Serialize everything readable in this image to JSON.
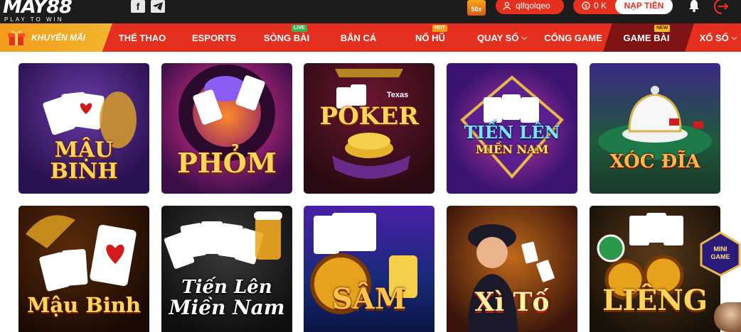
{
  "header": {
    "logo_main": "MAY88",
    "logo_tagline": "PLAY TO WIN",
    "promo_badge": "50x",
    "username": "qlfqolqeo",
    "balance": "0 K",
    "deposit_label": "NẠP TIỀN"
  },
  "nav": {
    "promo_label": "KHUYẾN MÃI",
    "items": [
      {
        "label": "THỂ THAO",
        "badge": ""
      },
      {
        "label": "ESPORTS",
        "badge": ""
      },
      {
        "label": "SÒNG BÀI",
        "badge": "LIVE"
      },
      {
        "label": "BẮN CÁ",
        "badge": ""
      },
      {
        "label": "NỔ HŨ",
        "badge": "HOT"
      },
      {
        "label": "QUAY SỐ",
        "badge": ""
      },
      {
        "label": "CỔNG GAME",
        "badge": ""
      },
      {
        "label": "GAME BÀI",
        "badge": "NEW"
      },
      {
        "label": "XỔ SỐ",
        "badge": ""
      }
    ]
  },
  "games": [
    {
      "label_line1": "MẬU",
      "label_line2": "BINH",
      "theme": "purple"
    },
    {
      "label_line1": "PHỎM",
      "label_line2": "",
      "theme": "violet"
    },
    {
      "label_line1": "Texas",
      "label_line2": "POKER",
      "theme": "wine"
    },
    {
      "label_line1": "TIẾN LÊN",
      "label_line2": "MIỀN NAM",
      "theme": "stage"
    },
    {
      "label_line1": "XÓC ĐĨA",
      "label_line2": "",
      "theme": "arena"
    },
    {
      "label_line1": "Mậu Binh",
      "label_line2": "",
      "theme": "dark"
    },
    {
      "label_line1": "Tiến Lên",
      "label_line2": "Miền Nam",
      "theme": "dark"
    },
    {
      "label_line1": "SÂM",
      "label_line2": "",
      "theme": "blue"
    },
    {
      "label_line1": "Xì Tố",
      "label_line2": "",
      "theme": "amber"
    },
    {
      "label_line1": "LIÊNG",
      "label_line2": "",
      "theme": "green"
    }
  ],
  "mini_game_badge": "MINI GAME",
  "colors": {
    "header_bg": "#1c1c1c",
    "nav_bg": "#e5301f",
    "nav_active": "#801414",
    "promo_bg": "#f39b1b",
    "label_gold": "#ffd65a"
  }
}
